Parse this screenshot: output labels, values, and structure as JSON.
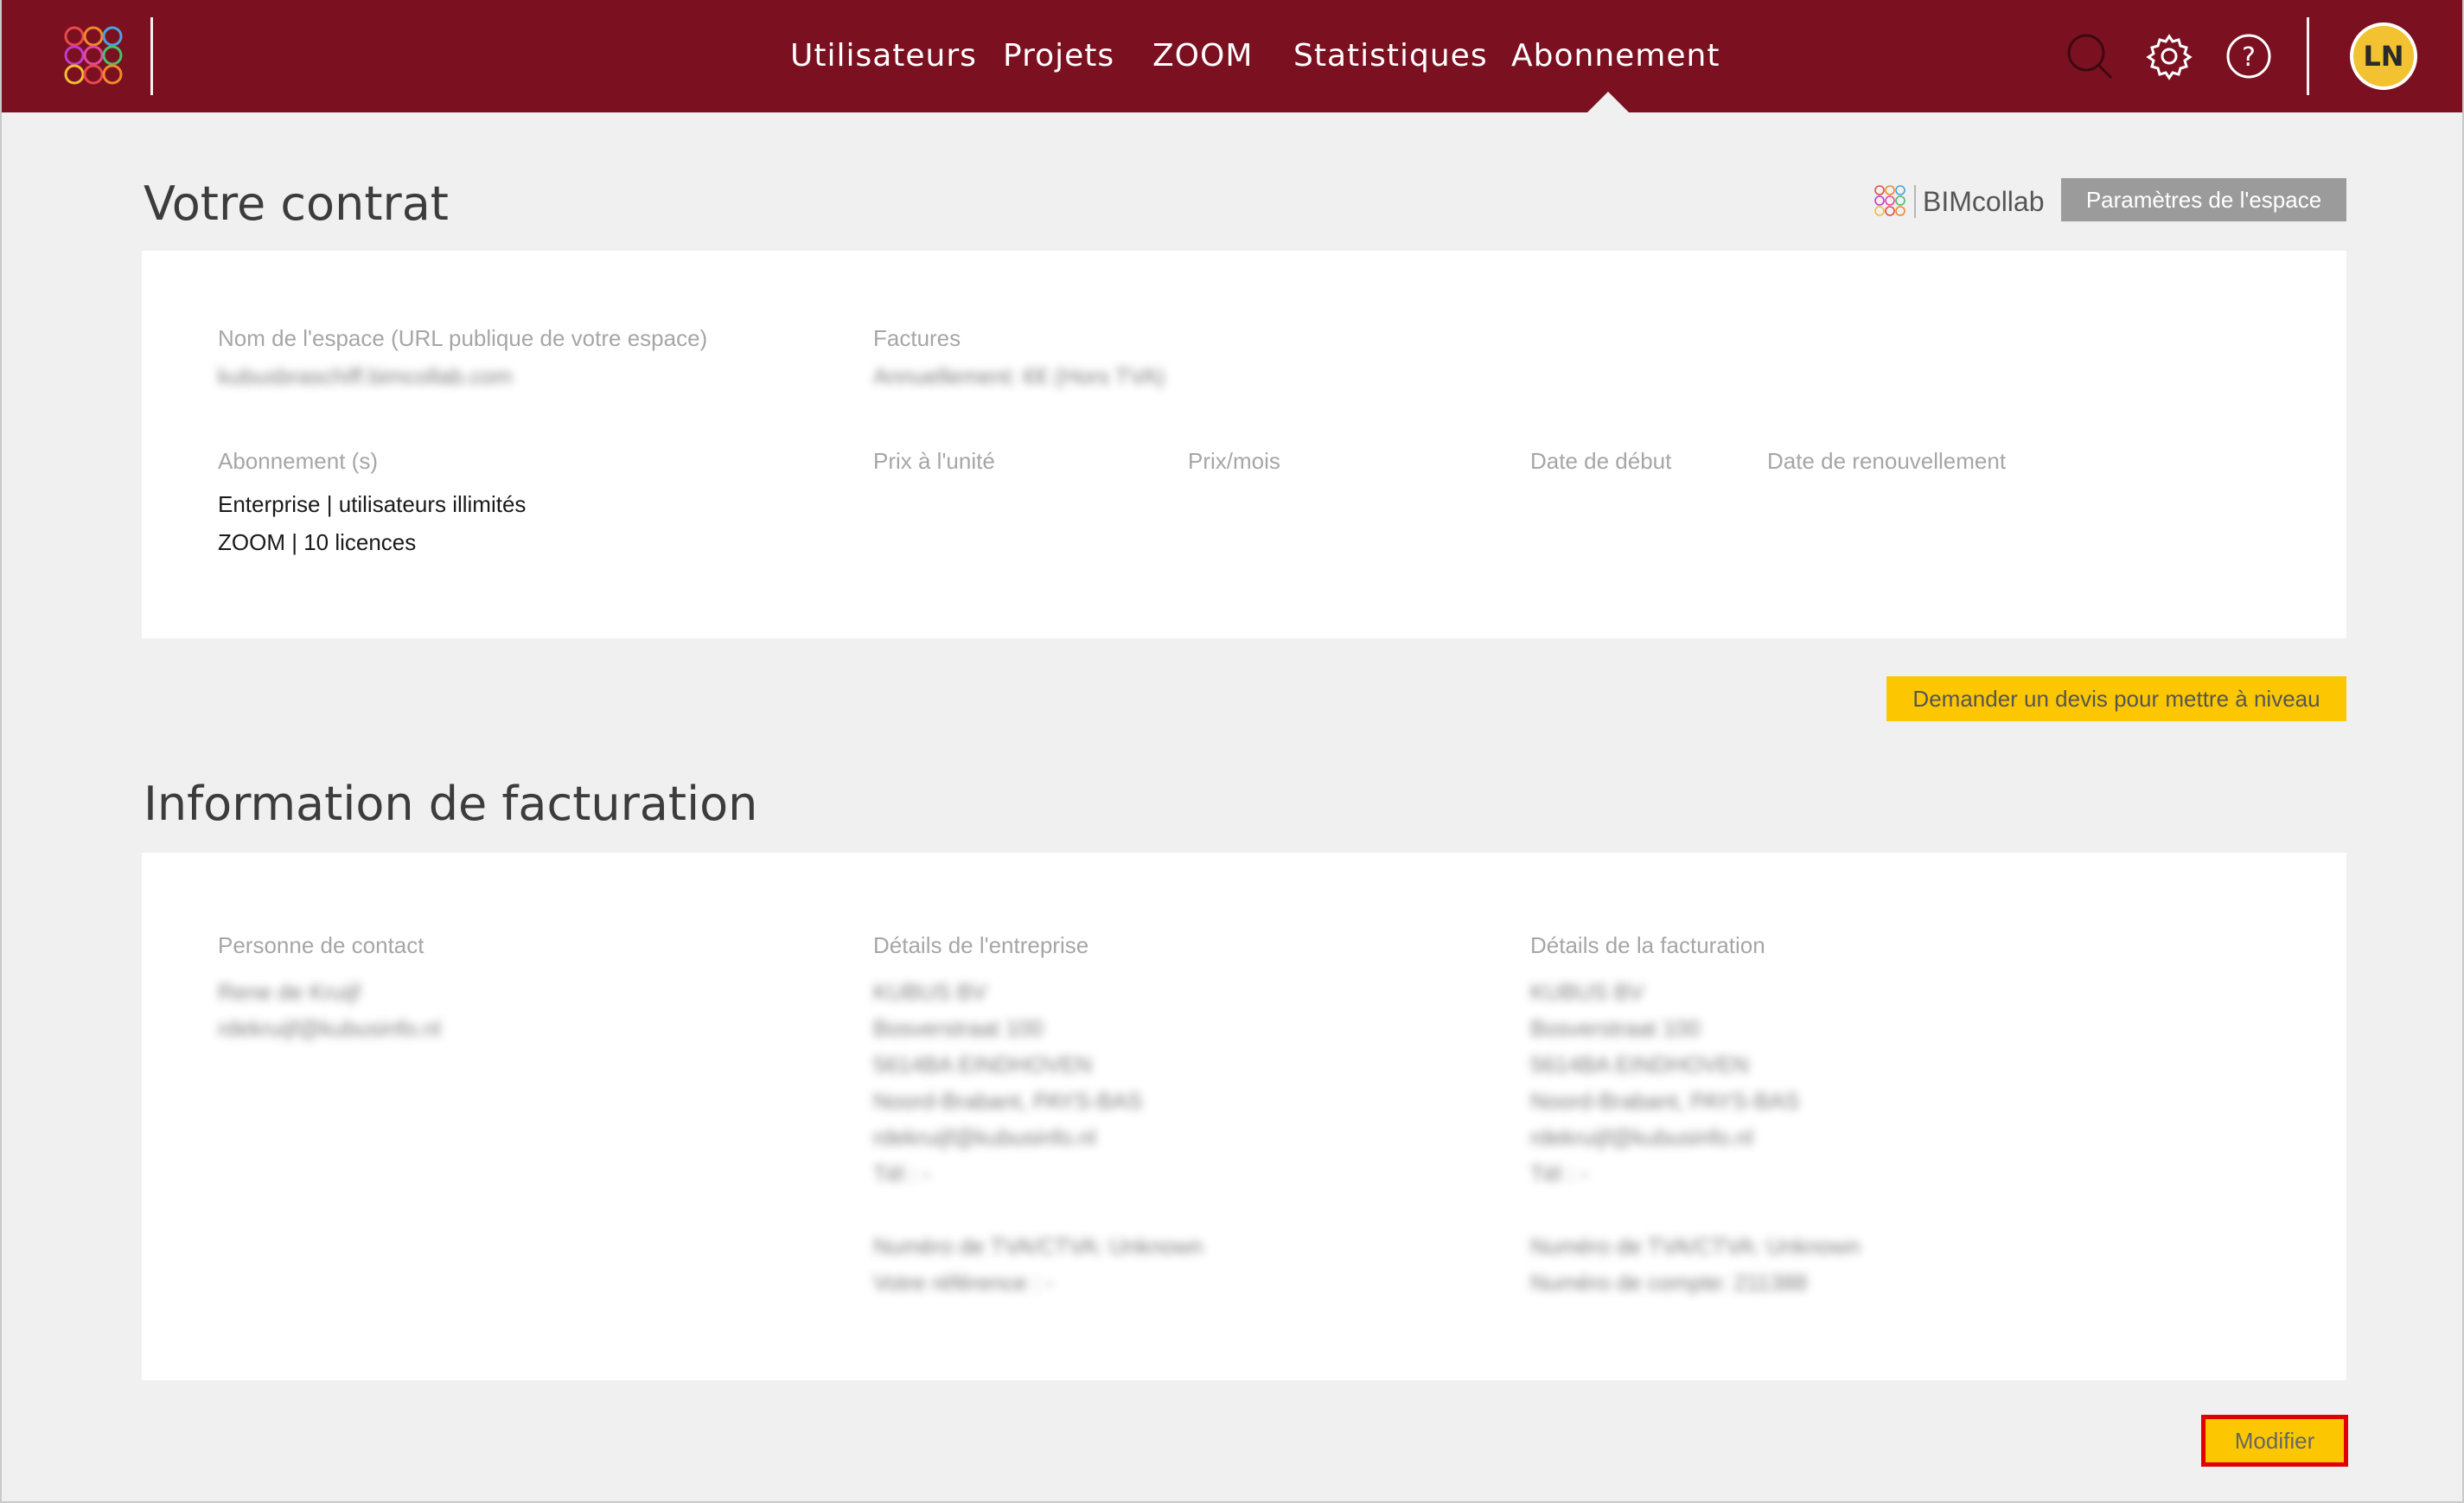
{
  "nav": {
    "items": [
      {
        "label": "Utilisateurs"
      },
      {
        "label": "Projets"
      },
      {
        "label": "ZOOM"
      },
      {
        "label": "Statistiques"
      },
      {
        "label": "Abonnement"
      }
    ],
    "active_index": 4,
    "avatar_initials": "LN",
    "icons": [
      "logo-icon",
      "search-icon",
      "gear-icon",
      "help-icon"
    ]
  },
  "contract": {
    "title": "Votre contrat",
    "brand_text": "BIMcollab",
    "space_settings_button": "Paramètres de l'espace",
    "space_name_label": "Nom de l'espace (URL publique de votre espace)",
    "space_name_value": "kubusbraschiff.bimcollab.com",
    "invoices_label": "Factures",
    "invoices_value": "Annuellement: €€ (Hors TVA)",
    "subscription_label": "Abonnement (s)",
    "unit_price_label": "Prix à l'unité",
    "price_month_label": "Prix/mois",
    "start_date_label": "Date de début",
    "renewal_date_label": "Date de renouvellement",
    "subscriptions": [
      "Enterprise | utilisateurs illimités",
      "ZOOM | 10 licences"
    ],
    "upgrade_button": "Demander un devis pour mettre à niveau"
  },
  "billing": {
    "title": "Information de facturation",
    "contact_label": "Personne de contact",
    "company_label": "Détails de l'entreprise",
    "billing_label": "Détails de la facturation",
    "contact_lines": [
      "Rene de Kruijf",
      "rdekruijf@kubusinfo.nl"
    ],
    "company_lines": [
      "KUBUS BV",
      "Bosverstraat 100",
      "5614BA EINDHOVEN",
      "Noord-Brabant, PAYS-BAS",
      "rdekruijf@kubusinfo.nl",
      "Tél : -",
      "",
      "Numéro de TVA/CTVA: Unknown",
      "Votre référence : -"
    ],
    "billing_lines": [
      "KUBUS BV",
      "Bosverstraat 100",
      "5614BA EINDHOVEN",
      "Noord-Brabant, PAYS-BAS",
      "rdekruijf@kubusinfo.nl",
      "Tél : -",
      "",
      "Numéro de TVA/CTVA: Unknown",
      "Numéro de compte: 211388"
    ],
    "modify_button": "Modifier"
  },
  "colors": {
    "header": "#7b1021",
    "primary_button": "#fdc700",
    "secondary_button": "#9b9b9b",
    "highlight_border": "#e00000"
  }
}
